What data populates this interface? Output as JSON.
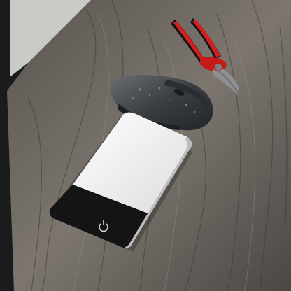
{
  "image": {
    "subjects": [
      "wooden-desk",
      "wireless-mouse",
      "pliers",
      "power-bank"
    ],
    "colors": {
      "desk_dark": "#4a4542",
      "desk_light": "#8a847e",
      "wall": "#c9cbc6",
      "mouse_body": "#3b3f43",
      "pliers_handle_red": "#d11e1e",
      "pliers_handle_black": "#1a1a1a",
      "pliers_jaw": "#8d9195",
      "powerbank_white": "#efefef",
      "powerbank_black": "#141414"
    }
  },
  "powerbank": {
    "brand_mark": "",
    "button_icon": "power-icon"
  }
}
